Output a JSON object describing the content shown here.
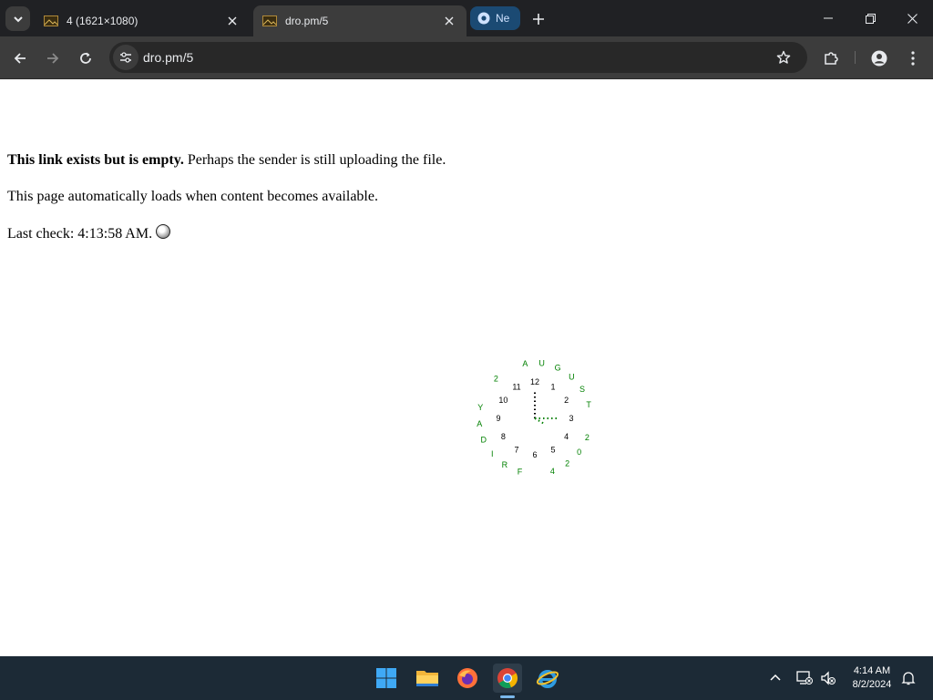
{
  "browser": {
    "tabs": [
      {
        "title": "4 (1621×1080)",
        "active": false
      },
      {
        "title": "dro.pm/5",
        "active": true
      }
    ],
    "tab_group_label": "Ne",
    "url": "dro.pm/5"
  },
  "page": {
    "line1_bold": "This link exists but is empty.",
    "line1_rest": " Perhaps the sender is still uploading the file.",
    "line2": "This page automatically loads when content becomes available.",
    "line3": "Last check: 4:13:58 AM.",
    "clock": {
      "numbers": [
        "12",
        "1",
        "2",
        "3",
        "4",
        "5",
        "6",
        "7",
        "8",
        "9",
        "10",
        "11"
      ],
      "outer_text": "AUGUST 2024 FRIDAY 2",
      "number_color": "#000000",
      "outer_color": "#008000"
    }
  },
  "taskbar": {
    "apps": [
      "windows-start",
      "file-explorer",
      "firefox",
      "chrome",
      "internet-explorer"
    ],
    "time": "4:14 AM",
    "date": "8/2/2024"
  },
  "colors": {
    "tabstrip": "#202124",
    "toolbar": "#3c3c3c",
    "taskbar": "#1c2a36"
  }
}
